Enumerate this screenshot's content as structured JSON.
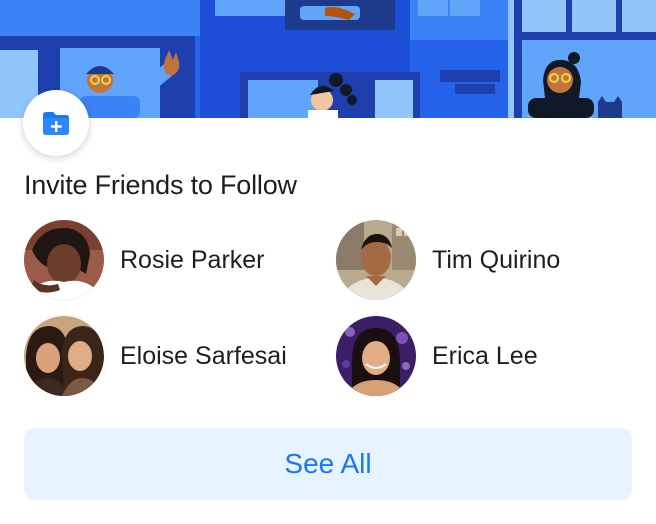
{
  "card": {
    "title": "Invite Friends to Follow",
    "accent_color": "#1877f2",
    "button_bg_color": "#e7f3ff",
    "banner_color": "#1d4ed8"
  },
  "badge": {
    "icon": "folder-plus-icon"
  },
  "friends": [
    {
      "name": "Rosie Parker"
    },
    {
      "name": "Tim Quirino"
    },
    {
      "name": "Eloise Sarfesai"
    },
    {
      "name": "Erica Lee"
    }
  ],
  "actions": {
    "see_all_label": "See All"
  }
}
